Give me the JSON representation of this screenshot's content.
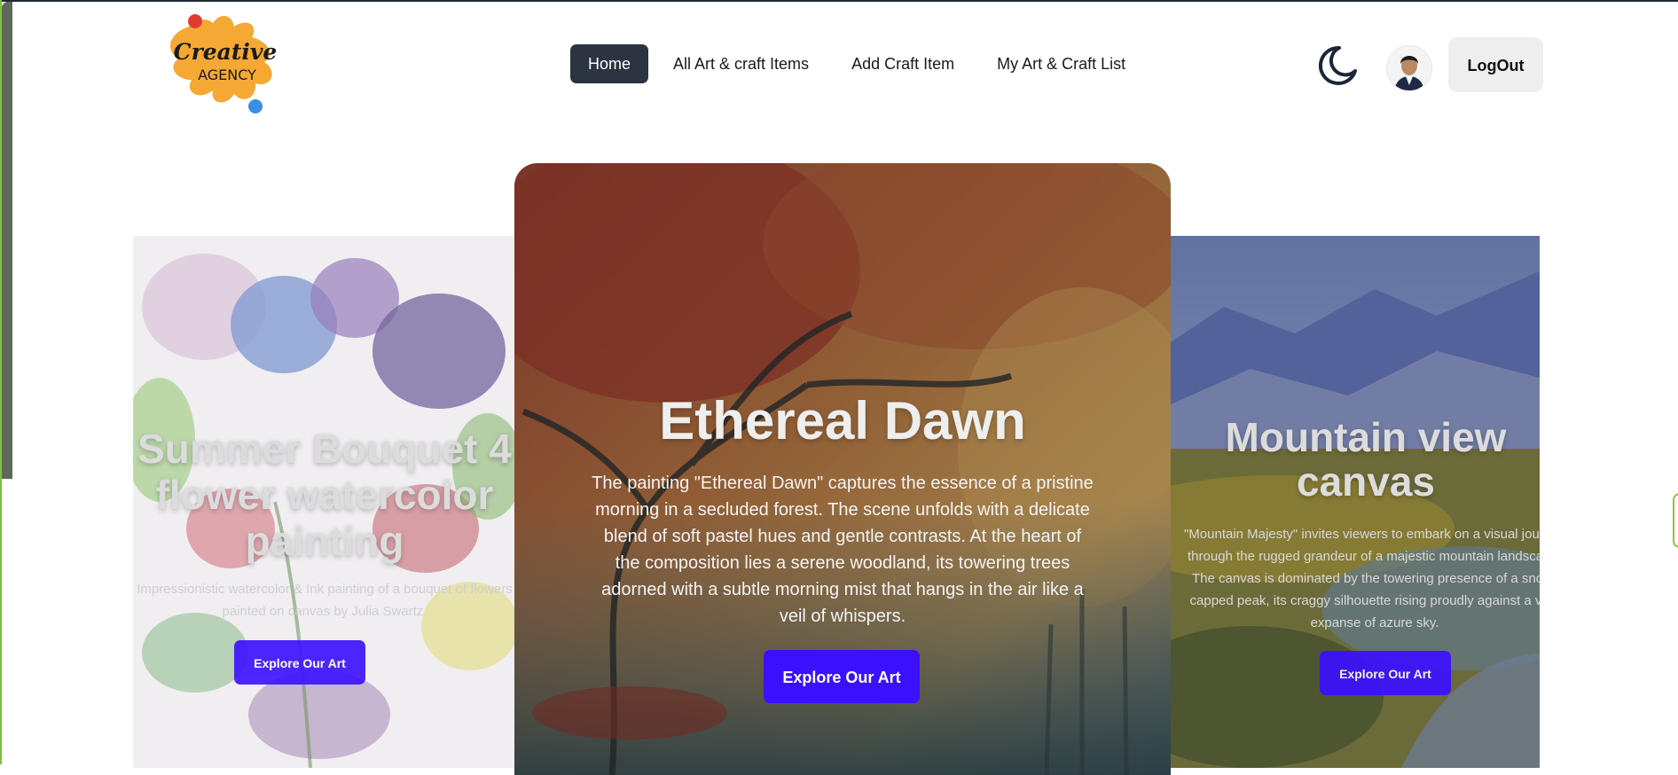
{
  "logo": {
    "line1": "Creative",
    "line2": "AGENCY"
  },
  "nav": {
    "items": [
      {
        "label": "Home",
        "active": true
      },
      {
        "label": "All Art & craft Items",
        "active": false
      },
      {
        "label": "Add Craft Item",
        "active": false
      },
      {
        "label": "My Art & Craft List",
        "active": false
      }
    ]
  },
  "header": {
    "theme_icon": "moon-icon",
    "avatar_icon": "user-avatar",
    "logout_label": "LogOut"
  },
  "slides": [
    {
      "title": "Summer Bouquet 4 flower watercolor painting",
      "description": "Impressionistic watercolor & Ink painting of a bouquet of flowers painted on canvas by Julia Swartz.",
      "button": "Explore Our Art"
    },
    {
      "title": "Ethereal Dawn",
      "description": "The painting \"Ethereal Dawn\" captures the essence of a pristine morning in a secluded forest. The scene unfolds with a delicate blend of soft pastel hues and gentle contrasts. At the heart of the composition lies a serene woodland, its towering trees adorned with a subtle morning mist that hangs in the air like a veil of whispers.",
      "button": "Explore Our Art"
    },
    {
      "title": "Mountain view canvas",
      "description": "\"Mountain Majesty\" invites viewers to embark on a visual journey through the rugged grandeur of a majestic mountain landscape. The canvas is dominated by the towering presence of a snow-capped peak, its craggy silhouette rising proudly against a vast expanse of azure sky.",
      "button": "Explore Our Art"
    }
  ],
  "colors": {
    "accent": "#3b10ff",
    "nav_active": "#2b3440"
  }
}
